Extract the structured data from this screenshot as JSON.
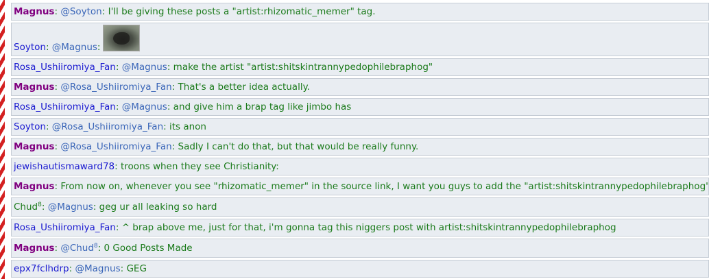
{
  "messages": [
    {
      "user": "Magnus",
      "role": "admin",
      "mention": "@Soyton",
      "text": "I'll be giving these posts a \"artist:rhizomatic_memer\" tag."
    },
    {
      "user": "Soyton",
      "role": "user",
      "mention": "@Magnus",
      "text": "",
      "image": "thumbnail-image"
    },
    {
      "user": "Rosa_Ushiiromiya_Fan",
      "role": "user",
      "mention": "@Magnus",
      "text": "make the artist \"artist:shitskintrannypedophilebraphog\""
    },
    {
      "user": "Magnus",
      "role": "admin",
      "mention": "@Rosa_Ushiiromiya_Fan",
      "text": "That's a better idea actually."
    },
    {
      "user": "Rosa_Ushiiromiya_Fan",
      "role": "user",
      "mention": "@Magnus",
      "text": "and give him a brap tag like jimbo has"
    },
    {
      "user": "Soyton",
      "role": "user",
      "mention": "@Rosa_Ushiiromiya_Fan",
      "text": "its anon"
    },
    {
      "user": "Magnus",
      "role": "admin",
      "mention": "@Rosa_Ushiiromiya_Fan",
      "text": "Sadly I can't do that, but that would be really funny."
    },
    {
      "user": "jewishautismaward78",
      "role": "user",
      "mention": "",
      "text": "troons when they see Christianity:"
    },
    {
      "user": "Magnus",
      "role": "admin",
      "mention": "",
      "text": "From now on, whenever you see \"rhizomatic_memer\" in the source link, I want you guys to add the \"artist:shitskintrannypedophilebraphog\" tag."
    },
    {
      "user": "Chud",
      "user_sup": "8",
      "role": "green",
      "mention": "@Magnus",
      "text": "geg ur all leaking so hard"
    },
    {
      "user": "Rosa_Ushiiromiya_Fan",
      "role": "user",
      "mention": "",
      "text": "^ brap above me, just for that, i'm gonna tag this niggers post with artist:shitskintrannypedophilebraphog"
    },
    {
      "user": "Magnus",
      "role": "admin",
      "mention": "@Chud",
      "mention_sup": "8",
      "text": "0 Good Posts Made"
    },
    {
      "user": "epx7fclhdrp",
      "role": "user",
      "mention": "@Magnus",
      "text": "GEG"
    }
  ],
  "colors": {
    "admin_name": "#800080",
    "user_name": "#1a1ad0",
    "message_text": "#1a7a1a",
    "mention": "#3a66b8",
    "row_background": "#e9edf2",
    "stripe": "#d42020"
  }
}
